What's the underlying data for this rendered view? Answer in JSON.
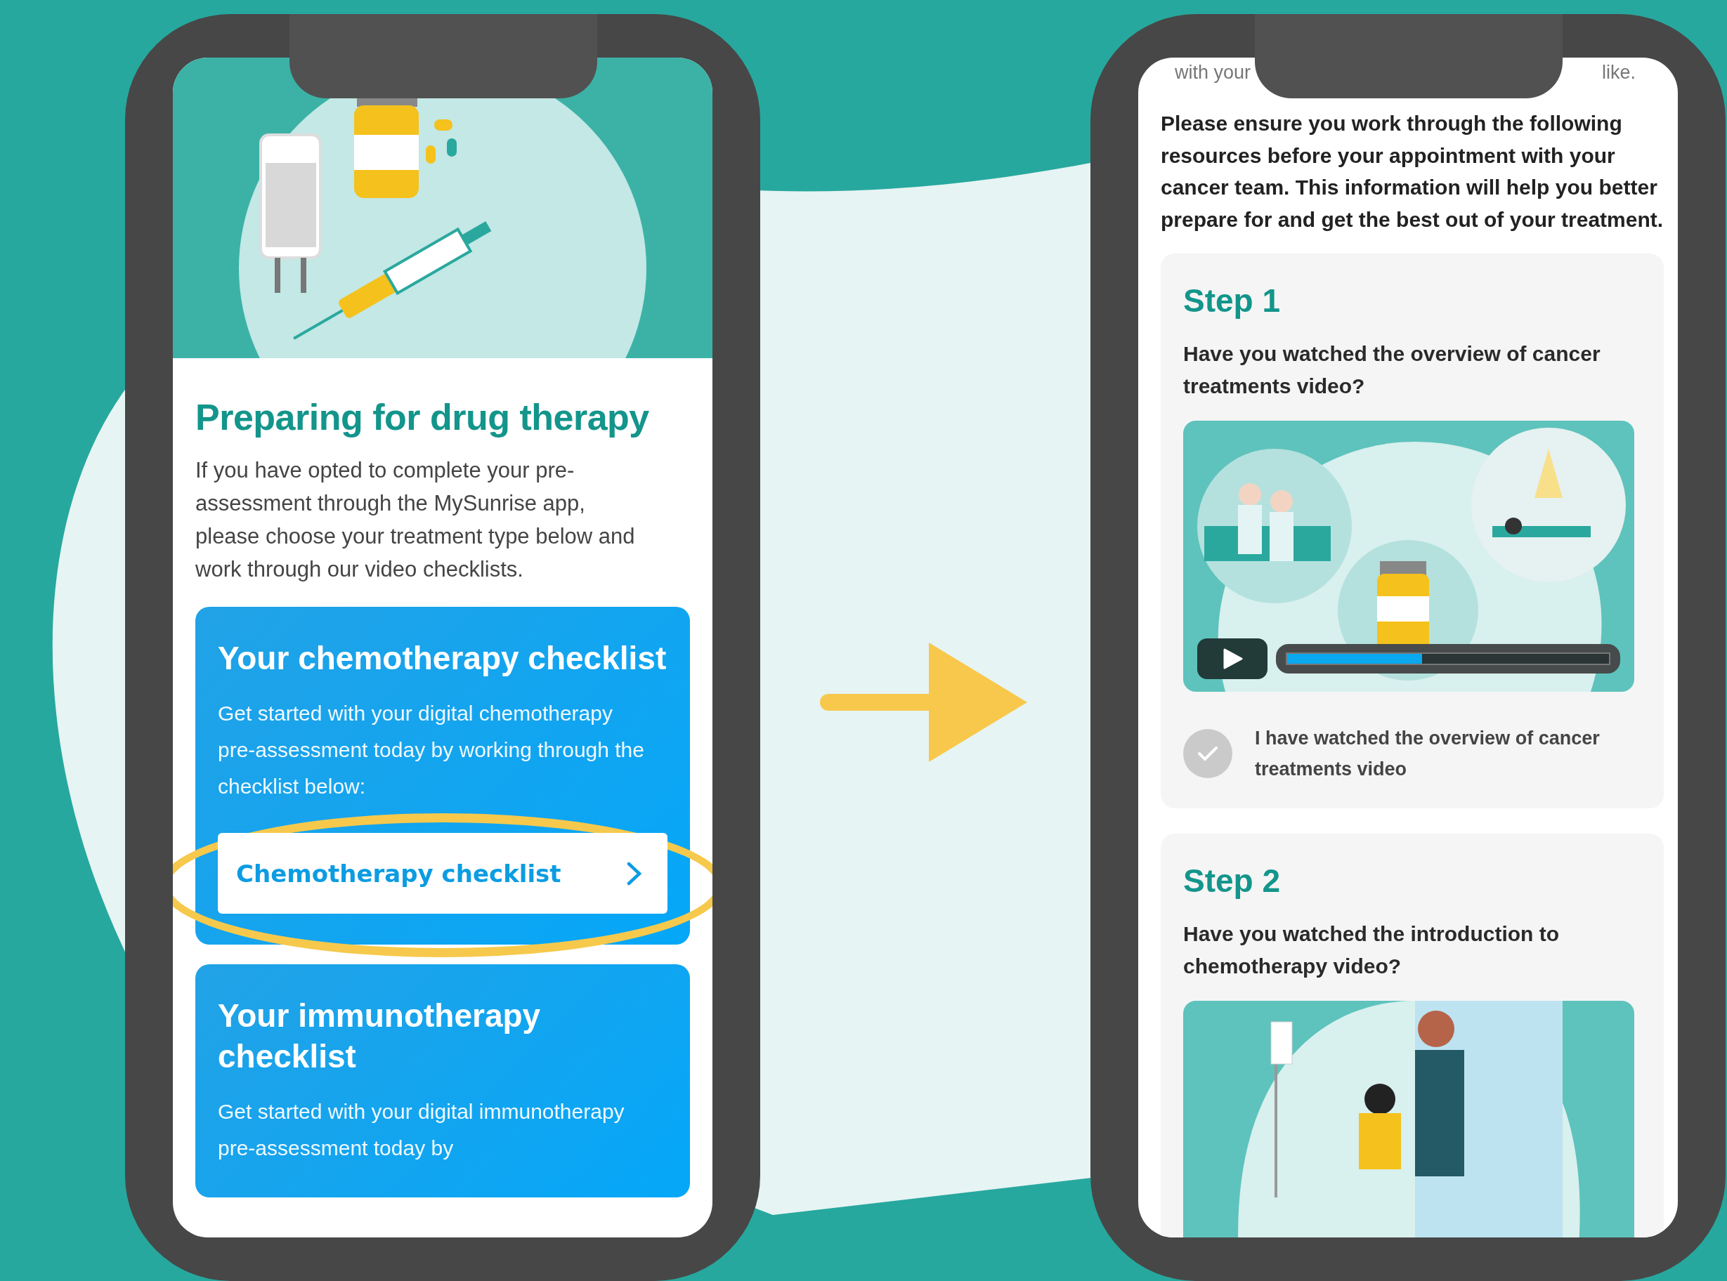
{
  "left_screen": {
    "title": "Preparing for drug therapy",
    "intro": "If you have opted to complete your pre-assessment through the MySunrise app, please choose your treatment type below and work through our video checklists.",
    "cards": [
      {
        "title": "Your chemotherapy checklist",
        "text": "Get started with your digital chemotherapy pre-assessment today by working through the checklist below:",
        "button": "Chemotherapy checklist",
        "highlighted": true
      },
      {
        "title": "Your immunotherapy checklist",
        "text": "Get started with your digital immunotherapy pre-assessment today by",
        "highlighted": false
      }
    ]
  },
  "right_screen": {
    "top_text_left": "with your",
    "top_text_right": "like.",
    "intro": "Please ensure you work through the following resources before your appointment with your cancer team. This information will help you better prepare for and get the best out of your treatment.",
    "steps": [
      {
        "title": "Step 1",
        "question": "Have you watched the overview of cancer treatments video?",
        "video": {
          "kind": "clinic",
          "level": 0.42
        },
        "confirmation": {
          "label": "I have watched the overview of cancer treatments video",
          "checked": false
        }
      },
      {
        "title": "Step 2",
        "question": "Have you watched the introduction to chemotherapy video?",
        "video": {
          "kind": "nurse"
        }
      }
    ]
  }
}
